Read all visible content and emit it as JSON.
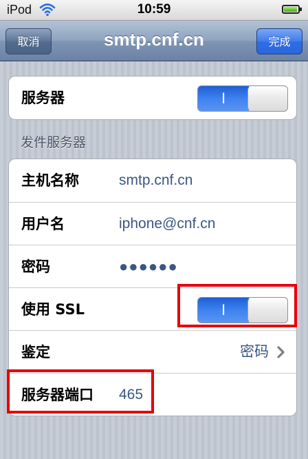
{
  "status_bar": {
    "carrier": "iPod",
    "time": "10:59",
    "battery_level": 0.95
  },
  "nav": {
    "title": "smtp.cnf.cn",
    "cancel_label": "取消",
    "done_label": "完成"
  },
  "server_toggle": {
    "label": "服务器",
    "on_text": "I",
    "on": true
  },
  "section": {
    "header": "发件服务器",
    "rows": [
      {
        "label": "主机名称",
        "value": "smtp.cnf.cn"
      },
      {
        "label": "用户名",
        "value": "iphone@cnf.cn"
      },
      {
        "label": "密码",
        "value": "●●●●●●"
      },
      {
        "label": "使用 SSL",
        "toggle_text": "I",
        "on": true
      },
      {
        "label": "鉴定",
        "value": "密码"
      },
      {
        "label": "服务器端口",
        "value": "465"
      }
    ]
  },
  "colors": {
    "highlight": "#e5000b",
    "value_text": "#3a5682",
    "switch_on": "#3d82f0"
  },
  "icons": {
    "wifi": "wifi-icon",
    "battery": "battery-icon",
    "chevron": "chevron-right-icon"
  }
}
